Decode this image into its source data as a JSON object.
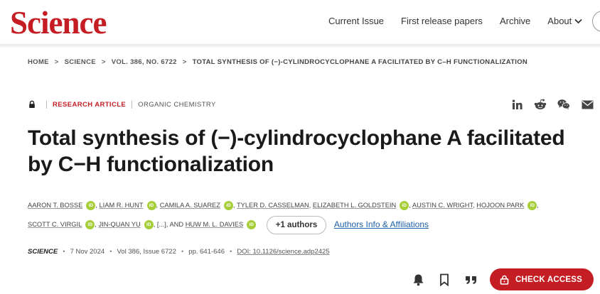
{
  "header": {
    "logo": "Science",
    "nav": [
      "Current Issue",
      "First release papers",
      "Archive"
    ],
    "about_label": "About"
  },
  "breadcrumb": [
    "HOME",
    "SCIENCE",
    "VOL. 386, NO. 6722",
    "TOTAL SYNTHESIS OF (−)-CYLINDROCYCLOPHANE A FACILITATED BY C–H FUNCTIONALIZATION"
  ],
  "article": {
    "type": "RESEARCH ARTICLE",
    "subject": "ORGANIC CHEMISTRY",
    "title_line1": "Total synthesis of (−)-cylindrocyclophane A facilitated",
    "title_line2": "by C−H functionalization"
  },
  "share_icons": [
    "linkedin-icon",
    "reddit-icon",
    "wechat-icon",
    "email-icon"
  ],
  "authors": {
    "list": [
      "AARON T. BOSSE",
      "LIAM R. HUNT",
      "CAMILA A. SUAREZ",
      "TYLER D. CASSELMAN",
      "ELIZABETH L. GOLDSTEIN",
      "AUSTIN C. WRIGHT",
      "HOJOON PARK",
      "SCOTT C. VIRGIL",
      "JIN-QUAN YU",
      "HUW M. L. DAVIES"
    ],
    "orcid_label": "iD",
    "ellipsis": "[...], AND",
    "more_button": "+1 authors",
    "affiliations_link": "Authors Info & Affiliations"
  },
  "meta": {
    "journal": "SCIENCE",
    "date": "7 Nov 2024",
    "volume": "Vol 386, Issue 6722",
    "pages": "pp. 641-646",
    "doi": "DOI: 10.1126/science.adp2425"
  },
  "actions": {
    "icons": [
      "bell-icon",
      "bookmark-icon",
      "quote-icon"
    ],
    "check_access": "CHECK ACCESS"
  },
  "colors": {
    "brand_red": "#c41e24",
    "orcid_green": "#a6ce39",
    "link_blue": "#1f5fa8"
  }
}
